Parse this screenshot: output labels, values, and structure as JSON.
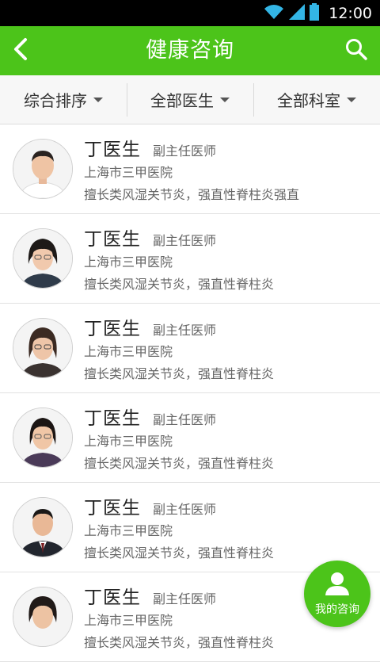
{
  "status_bar": {
    "time": "12:00"
  },
  "header": {
    "title": "健康咨询",
    "back_icon": "chevron-left-icon",
    "search_icon": "search-icon"
  },
  "filters": [
    {
      "label": "综合排序"
    },
    {
      "label": "全部医生"
    },
    {
      "label": "全部科室"
    }
  ],
  "doctors": [
    {
      "name": "丁医生",
      "title": "副主任医师",
      "hospital": "上海市三甲医院",
      "specialty": "擅长类风湿关节炎，强直性脊柱炎强直"
    },
    {
      "name": "丁医生",
      "title": "副主任医师",
      "hospital": "上海市三甲医院",
      "specialty": "擅长类风湿关节炎，强直性脊柱炎"
    },
    {
      "name": "丁医生",
      "title": "副主任医师",
      "hospital": "上海市三甲医院",
      "specialty": "擅长类风湿关节炎，强直性脊柱炎"
    },
    {
      "name": "丁医生",
      "title": "副主任医师",
      "hospital": "上海市三甲医院",
      "specialty": "擅长类风湿关节炎，强直性脊柱炎"
    },
    {
      "name": "丁医生",
      "title": "副主任医师",
      "hospital": "上海市三甲医院",
      "specialty": "擅长类风湿关节炎，强直性脊柱炎"
    },
    {
      "name": "丁医生",
      "title": "副主任医师",
      "hospital": "上海市三甲医院",
      "specialty": "擅长类风湿关节炎，强直性脊柱炎"
    }
  ],
  "fab": {
    "label": "我的咨询",
    "icon": "user-icon"
  },
  "colors": {
    "brand": "#4cc41a",
    "status_bar": "#000000",
    "text_primary": "#222222",
    "text_secondary": "#666666"
  }
}
